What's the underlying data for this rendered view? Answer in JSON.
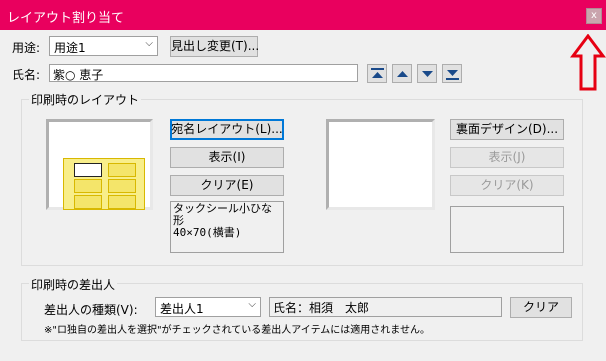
{
  "window": {
    "title": "レイアウト割り当て",
    "close_label": "x"
  },
  "usage": {
    "label": "用途:",
    "value": "用途1",
    "heading_button": "見出し変更(T)..."
  },
  "name": {
    "label": "氏名:",
    "value": "紫○ 恵子"
  },
  "layout_group": {
    "title": "印刷時のレイアウト",
    "address_layout_button": "宛名レイアウト(L)...",
    "show_button": "表示(I)",
    "clear_button": "クリア(E)",
    "info_text": "タックシール小ひな形\n40×70(横書)",
    "back_design_button": "裏面デザイン(D)...",
    "back_show_button": "表示(J)",
    "back_clear_button": "クリア(K)"
  },
  "sender_group": {
    "title": "印刷時の差出人",
    "type_label": "差出人の種類(V):",
    "type_value": "差出人1",
    "sender_name": "氏名：相須　太郎",
    "clear_button": "クリア",
    "note": "※\"ロ独自の差出人を選択\"がチェックされている差出人アイテムには適用されません。"
  },
  "colors": {
    "titlebar": "#e9005e",
    "annotation_arrow": "#e60012",
    "label_sheet": "#f4e56a"
  },
  "icons": [
    "move-first-icon",
    "move-up-icon",
    "move-down-icon",
    "move-last-icon",
    "chevron-down-icon",
    "red-arrow-annotation"
  ]
}
